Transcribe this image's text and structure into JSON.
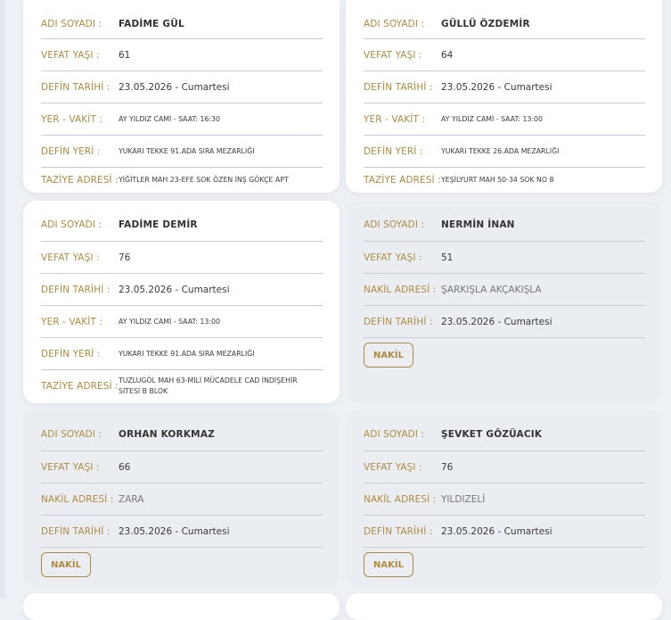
{
  "labels": {
    "name": "ADI SOYADI :",
    "age": "VEFAT YAŞI :",
    "burial_date": "DEFİN TARİHİ :",
    "place_time": "YER - VAKİT :",
    "burial_place": "DEFİN YERİ :",
    "condolence": "TAZİYE ADRESİ :",
    "transfer": "NAKİL ADRESİ :"
  },
  "cards": [
    {
      "name": "FADİME GÜL",
      "age": "61",
      "date": "23.05.2026 - Cumartesi",
      "place_time": "AY YILDIZ CAMİ - SAAT: 16:30",
      "burial_place": "YUKARI TEKKE 91.ADA SIRA MEZARLIĞI",
      "condolence": "YİĞİTLER MAH 23-EFE SOK ÖZEN İNŞ GÖKÇE APT"
    },
    {
      "name": "GÜLLÜ ÖZDEMİR",
      "age": "64",
      "date": "23.05.2026 - Cumartesi",
      "place_time": "AY YILDIZ CAMİ - SAAT: 13:00",
      "burial_place": "YUKARI TEKKE 26.ADA MEZARLIĞI",
      "condolence": "YEŞİLYURT MAH 50-34 SOK NO 8"
    },
    {
      "name": "FADİME DEMİR",
      "age": "76",
      "date": "23.05.2026 - Cumartesi",
      "place_time": "AY YILDIZ CAMİ - SAAT: 13:00",
      "burial_place": "YUKARI TEKKE 91.ADA SIRA MEZARLIĞI",
      "condolence": "TUZLUGÖL MAH 63-MİLİ MÜCADELE CAD İNDİŞEHİR SİTESİ B BLOK"
    },
    {
      "name": "NERMİN İNAN",
      "age": "51",
      "transfer": "ŞARKIŞLA AKÇAKIŞLA",
      "date": "23.05.2026 - Cumartesi",
      "button": "NAKİL"
    },
    {
      "name": "ORHAN KORKMAZ",
      "age": "66",
      "transfer": "ZARA",
      "date": "23.05.2026 - Cumartesi",
      "button": "NAKİL"
    },
    {
      "name": "ŞEVKET GÖZÜACIK",
      "age": "76",
      "transfer": "YILDIZELİ",
      "date": "23.05.2026 - Cumartesi",
      "button": "NAKİL"
    }
  ]
}
